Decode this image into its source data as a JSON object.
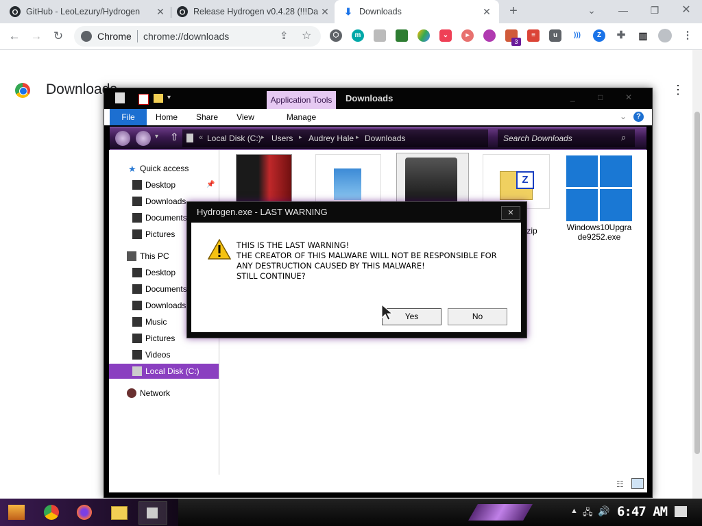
{
  "tabs": [
    {
      "title": "GitHub - LeoLezury/Hydrogen"
    },
    {
      "title": "Release Hydrogen v0.4.28 (!!!Da"
    },
    {
      "title": "Downloads"
    }
  ],
  "omnibox": {
    "site": "Chrome",
    "url": "chrome://downloads"
  },
  "extension_badge": "3",
  "downloads_page": {
    "title": "Downloads"
  },
  "explorer": {
    "title": "Downloads",
    "context_tab": "Application Tools",
    "ribbon_tabs": [
      "File",
      "Home",
      "Share",
      "View",
      "Manage"
    ],
    "breadcrumb": [
      "Local Disk (C:)",
      "Users",
      "Audrey Hale",
      "Downloads"
    ],
    "search_placeholder": "Search Downloads",
    "nav": {
      "quick_access": "Quick access",
      "qa_items": [
        "Desktop",
        "Downloads",
        "Documents",
        "Pictures"
      ],
      "this_pc": "This PC",
      "pc_items": [
        "Desktop",
        "Documents",
        "Downloads",
        "Music",
        "Pictures",
        "Videos",
        "Local Disk (C:)"
      ],
      "network": "Network"
    },
    "files": [
      {
        "name": ""
      },
      {
        "name": ""
      },
      {
        "name": ""
      },
      {
        "name": ".zip"
      },
      {
        "name": "Windows10Upgrade9252.exe"
      }
    ]
  },
  "dialog": {
    "title": "Hydrogen.exe - LAST WARNING",
    "lines": [
      "THIS IS THE LAST WARNING!",
      "THE CREATOR OF THIS MALWARE WILL NOT BE RESPONSIBLE FOR",
      "ANY DESTRUCTION CAUSED BY THIS MALWARE!",
      "STILL CONTINUE?"
    ],
    "yes": "Yes",
    "no": "No"
  },
  "taskbar": {
    "time": "6:47 AM"
  },
  "colors": {
    "chrome_tabstrip": "#dee1e6",
    "explorer_purple": "#5a2a78",
    "selected_nav": "#8a3fc0",
    "file_tab": "#1c6fd1"
  }
}
